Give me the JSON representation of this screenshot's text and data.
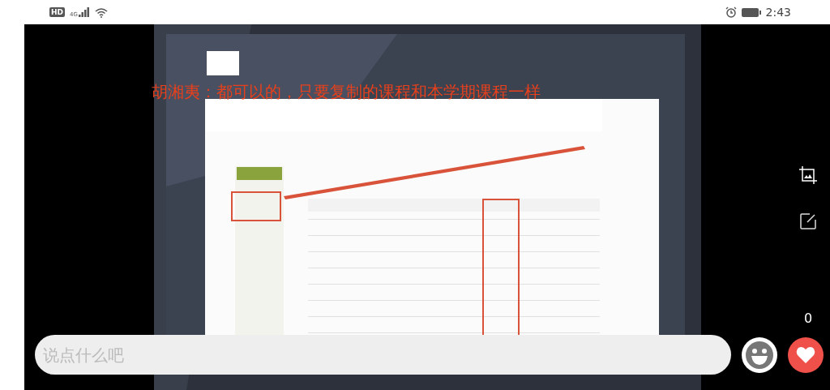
{
  "status_bar": {
    "hd_badge": "HD",
    "network": "4G",
    "time": "2:43"
  },
  "comment": {
    "text": "胡湘夷：都可以的，只要复制的课程和本学期课程一样"
  },
  "side_actions": {
    "like_count": "0"
  },
  "comment_input": {
    "placeholder": "说点什么吧"
  }
}
